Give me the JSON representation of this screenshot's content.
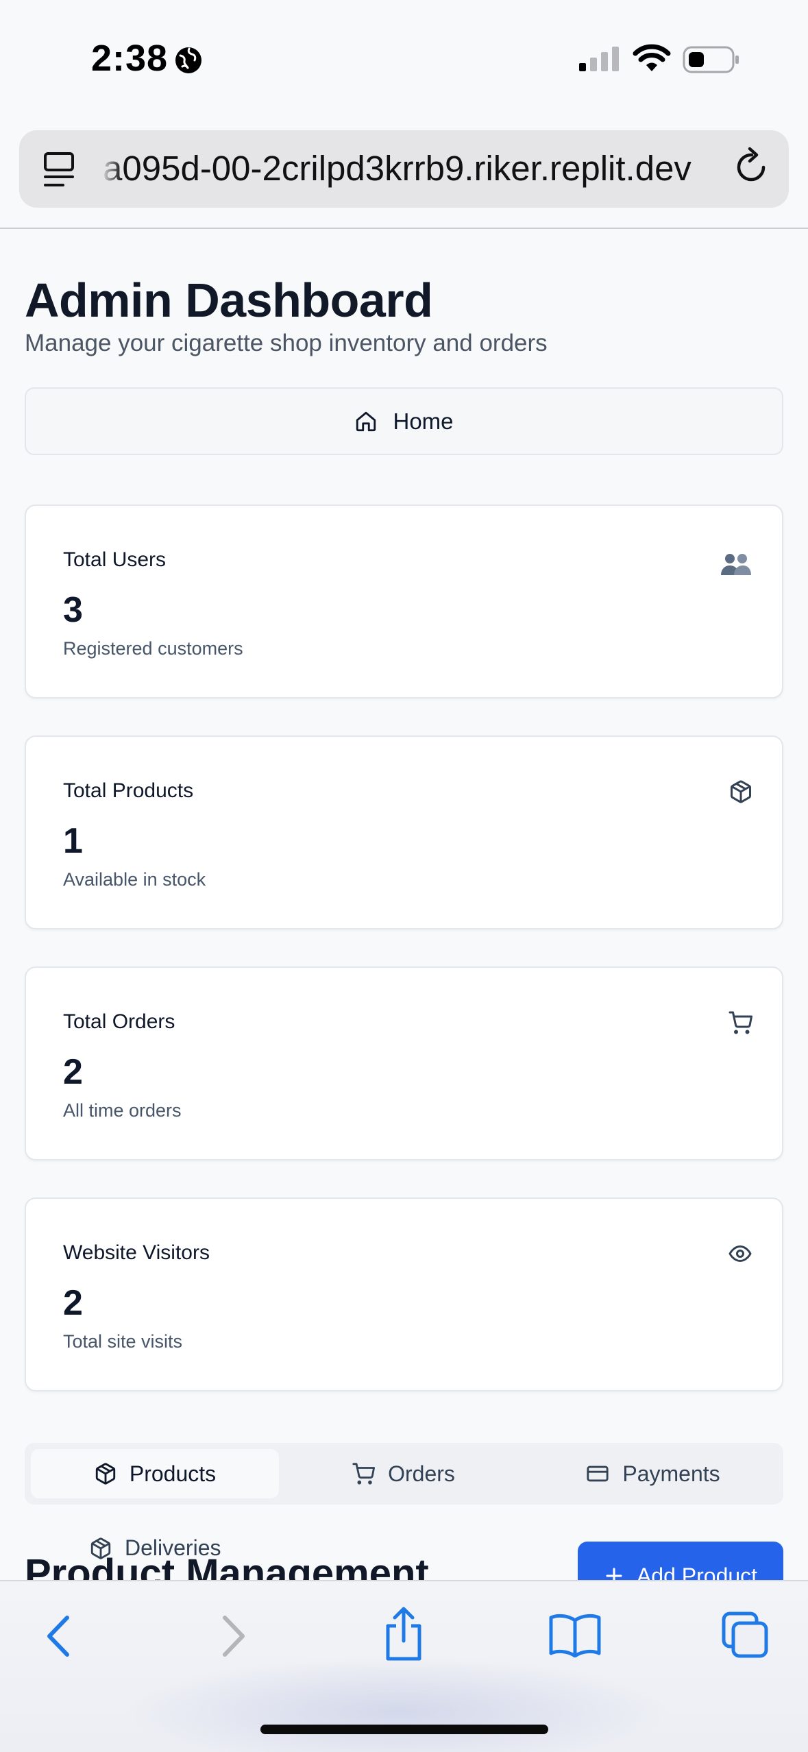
{
  "status_bar": {
    "time": "2:38"
  },
  "browser": {
    "url": "a095d-00-2crilpd3krrb9.riker.replit.dev"
  },
  "header": {
    "title": "Admin Dashboard",
    "subtitle": "Manage your cigarette shop inventory and orders"
  },
  "home_button": {
    "label": "Home",
    "icon": "home-icon"
  },
  "stats": [
    {
      "title": "Total Users",
      "value": "3",
      "description": "Registered customers",
      "icon": "users-icon"
    },
    {
      "title": "Total Products",
      "value": "1",
      "description": "Available in stock",
      "icon": "package-icon"
    },
    {
      "title": "Total Orders",
      "value": "2",
      "description": "All time orders",
      "icon": "cart-icon"
    },
    {
      "title": "Website Visitors",
      "value": "2",
      "description": "Total site visits",
      "icon": "eye-icon"
    }
  ],
  "tabs": [
    {
      "label": "Products",
      "icon": "package-icon",
      "active": true
    },
    {
      "label": "Orders",
      "icon": "cart-icon",
      "active": false
    },
    {
      "label": "Payments",
      "icon": "credit-card-icon",
      "active": false
    },
    {
      "label": "Deliveries",
      "icon": "package-icon",
      "active": false
    }
  ],
  "section": {
    "title": "Product Management",
    "add_button_label": "Add Product"
  },
  "colors": {
    "primary": "#2563eb",
    "background": "#f8f9fb",
    "card_border": "#e3e6ea",
    "text": "#0f172a",
    "muted": "#475569"
  }
}
